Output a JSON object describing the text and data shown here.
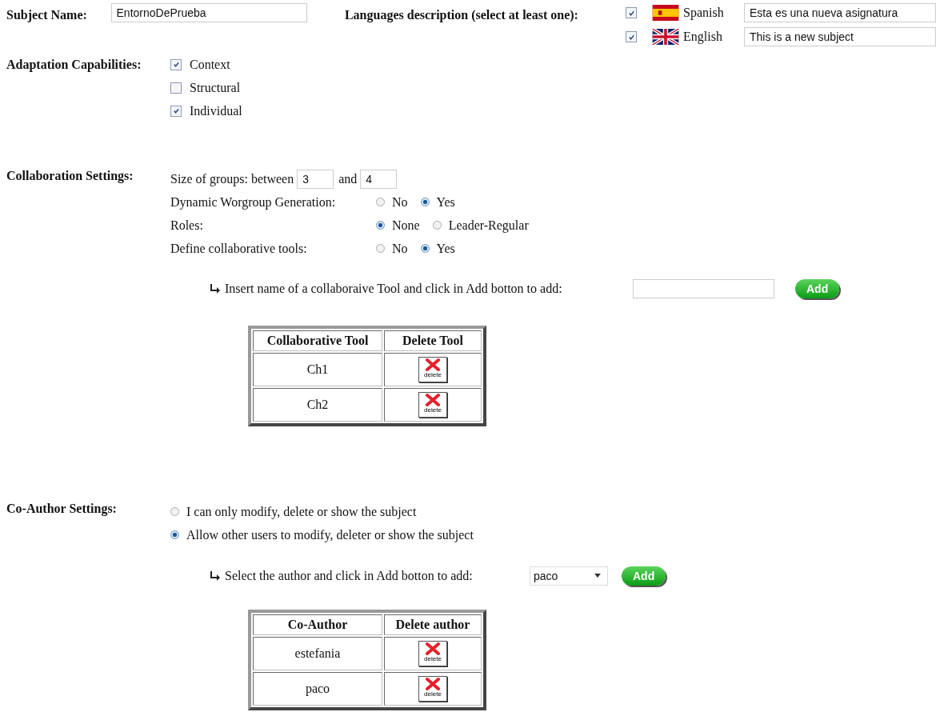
{
  "subject": {
    "label": "Subject Name:",
    "value": "EntornoDePrueba"
  },
  "languages": {
    "label": "Languages description (select at least one):",
    "items": [
      {
        "kind": "spain",
        "checked": true,
        "name": "Spanish",
        "value": "Esta es una nueva asignatura"
      },
      {
        "kind": "uk",
        "checked": true,
        "name": "English",
        "value": "This is a new subject"
      }
    ]
  },
  "adaptation": {
    "label": "Adaptation Capabilities:",
    "options": [
      {
        "label": "Context",
        "checked": true
      },
      {
        "label": "Structural",
        "checked": false
      },
      {
        "label": "Individual",
        "checked": true
      }
    ]
  },
  "collaboration": {
    "label": "Collaboration Settings:",
    "size_label": "Size of groups: between",
    "size_min": "3",
    "size_and": "and",
    "size_max": "4",
    "questions": [
      {
        "label": "Dynamic Worgroup Generation:",
        "options": [
          {
            "label": "No",
            "selected": false
          },
          {
            "label": "Yes",
            "selected": true
          }
        ]
      },
      {
        "label": "Roles:",
        "options": [
          {
            "label": "None",
            "selected": true
          },
          {
            "label": "Leader-Regular",
            "selected": false
          }
        ]
      },
      {
        "label": "Define collaborative tools:",
        "options": [
          {
            "label": "No",
            "selected": false
          },
          {
            "label": "Yes",
            "selected": true
          }
        ]
      }
    ],
    "prompt": "Insert name of a collaboraive Tool and click in Add botton to add:",
    "add_button": "Add",
    "table": {
      "columns": [
        "Collaborative Tool",
        "Delete Tool"
      ],
      "rows": [
        {
          "name": "Ch1",
          "delete": "delete"
        },
        {
          "name": "Ch2",
          "delete": "delete"
        }
      ]
    }
  },
  "coauthor": {
    "label": "Co-Author Settings:",
    "options": [
      {
        "label": "I can only modify, delete or show the subject",
        "selected": false
      },
      {
        "label": "Allow other users to modify, deleter or show the subject",
        "selected": true
      }
    ],
    "prompt": "Select the author and click in Add botton to add:",
    "select_value": "paco",
    "add_button": "Add",
    "table": {
      "columns": [
        "Co-Author",
        "Delete author"
      ],
      "rows": [
        {
          "name": "estefania",
          "delete": "delete"
        },
        {
          "name": "paco",
          "delete": "delete"
        }
      ]
    }
  }
}
